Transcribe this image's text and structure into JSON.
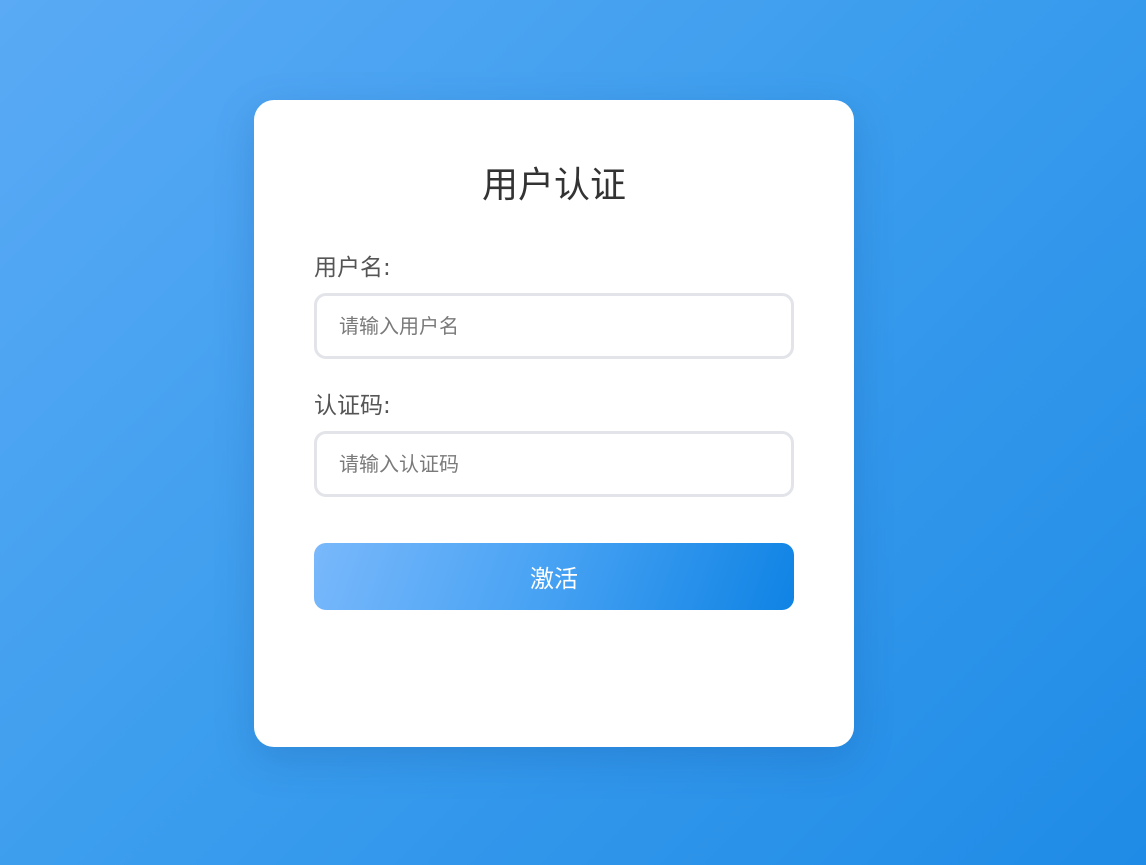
{
  "form": {
    "title": "用户认证",
    "username_label": "用户名:",
    "username_placeholder": "请输入用户名",
    "username_value": "",
    "code_label": "认证码:",
    "code_placeholder": "请输入认证码",
    "code_value": "",
    "submit_label": "激活"
  },
  "colors": {
    "background_start": "#5aaaf5",
    "background_end": "#1f8be6",
    "card_background": "#ffffff",
    "button_gradient_start": "#79b8fb",
    "button_gradient_end": "#0f83e4",
    "input_border": "#e2e4e9",
    "title_text": "#333333",
    "label_text": "#555555"
  }
}
